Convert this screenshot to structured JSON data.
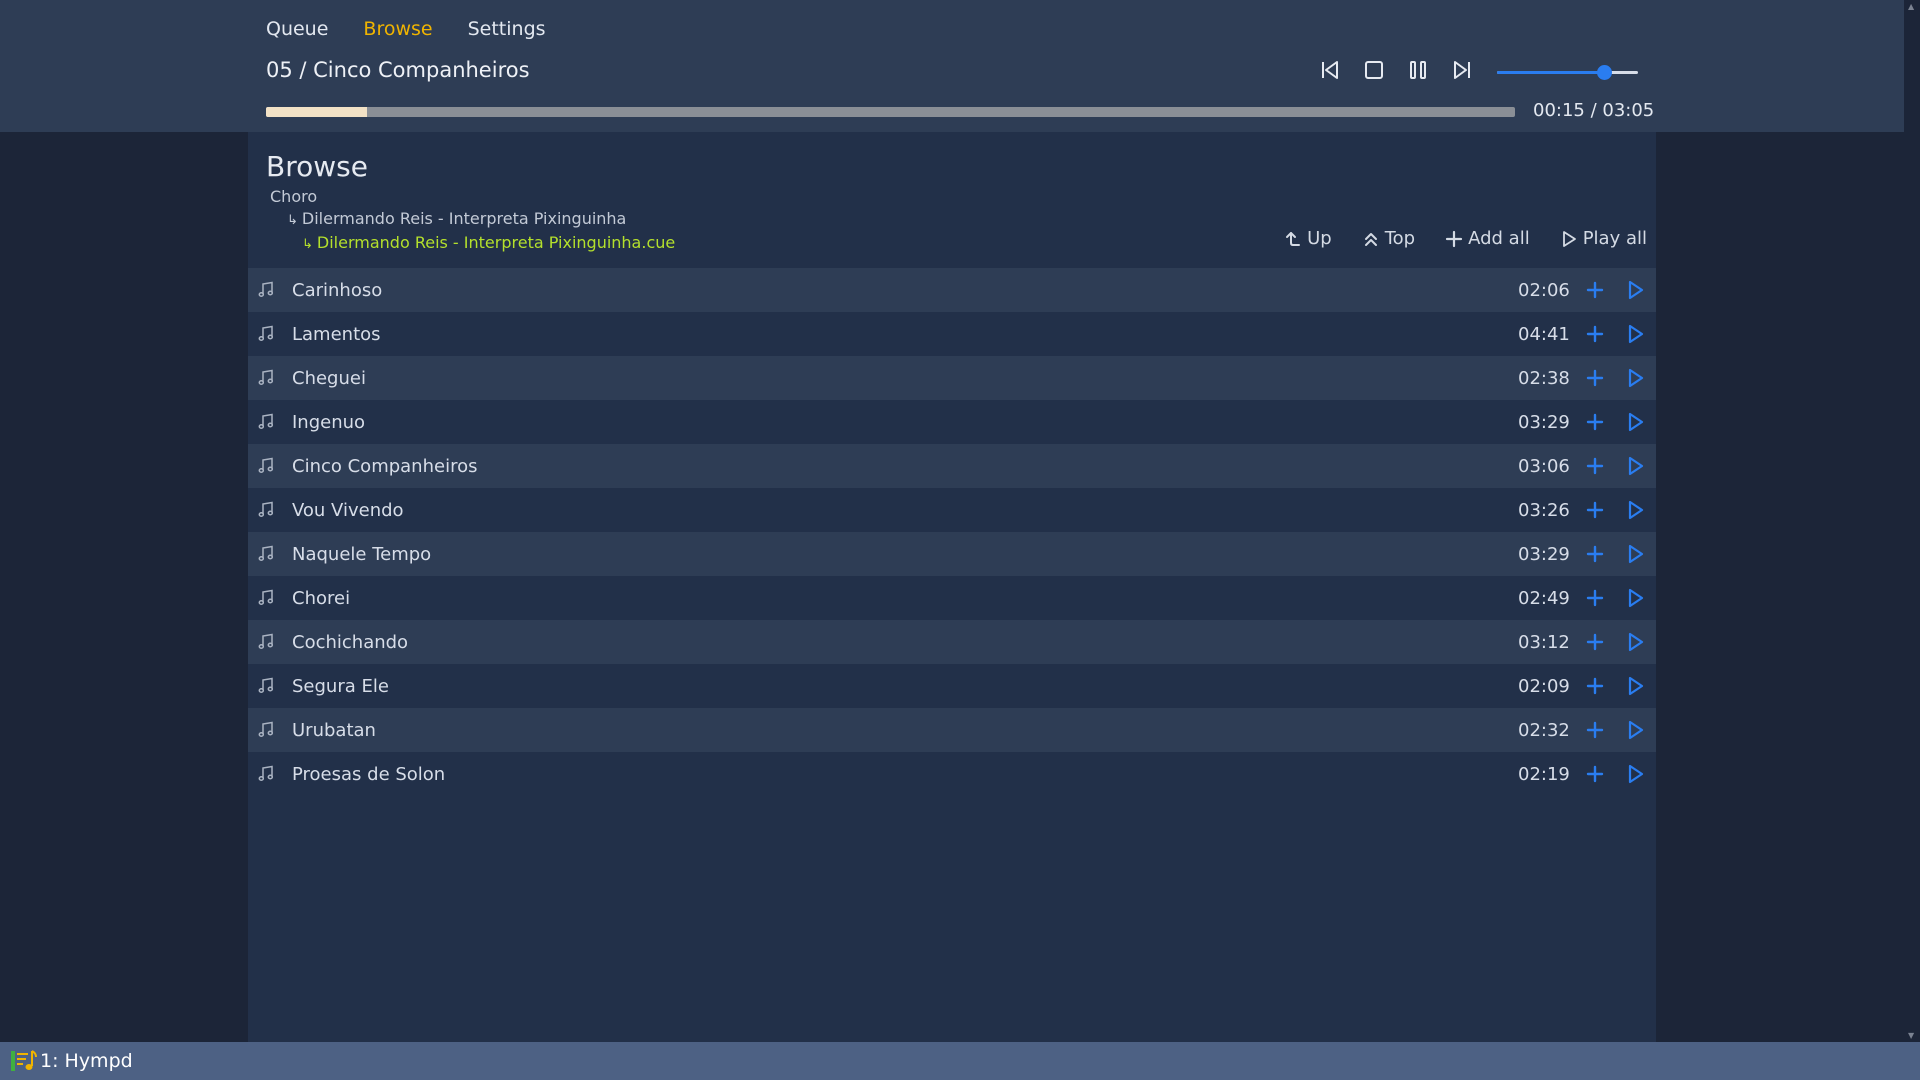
{
  "nav": {
    "tabs": [
      {
        "label": "Queue"
      },
      {
        "label": "Browse"
      },
      {
        "label": "Settings"
      }
    ],
    "active": "Browse"
  },
  "player": {
    "now_playing": "05 / Cinco Companheiros",
    "elapsed_total": "00:15 / 03:05",
    "progress_fraction": 0.081,
    "volume_fraction": 0.76,
    "controls": [
      "skip-previous-icon",
      "stop-icon",
      "pause-icon",
      "skip-next-icon"
    ]
  },
  "browse": {
    "title": "Browse",
    "breadcrumb": [
      "Choro",
      "Dilermando Reis - Interpreta Pixinguinha",
      "Dilermando Reis - Interpreta Pixinguinha.cue"
    ],
    "actions": [
      {
        "label": "Up",
        "icon": "up-arrow-icon"
      },
      {
        "label": "Top",
        "icon": "double-chevron-up-icon"
      },
      {
        "label": "Add all",
        "icon": "plus-icon"
      },
      {
        "label": "Play all",
        "icon": "play-icon"
      }
    ],
    "tracks": [
      {
        "title": "Carinhoso",
        "duration": "02:06"
      },
      {
        "title": "Lamentos",
        "duration": "04:41"
      },
      {
        "title": "Cheguei",
        "duration": "02:38"
      },
      {
        "title": "Ingenuo",
        "duration": "03:29"
      },
      {
        "title": "Cinco Companheiros",
        "duration": "03:06"
      },
      {
        "title": "Vou Vivendo",
        "duration": "03:26"
      },
      {
        "title": "Naquele Tempo",
        "duration": "03:29"
      },
      {
        "title": "Chorei",
        "duration": "02:49"
      },
      {
        "title": "Cochichando",
        "duration": "03:12"
      },
      {
        "title": "Segura Ele",
        "duration": "02:09"
      },
      {
        "title": "Urubatan",
        "duration": "02:32"
      },
      {
        "title": "Proesas de Solon",
        "duration": "02:19"
      }
    ]
  },
  "statusbar": {
    "label": "1: Hympd"
  },
  "colors": {
    "accent": "#2a7df0",
    "active_tab": "#f0b400",
    "breadcrumb_current": "#b4e02c",
    "header_bg": "#2e3d55",
    "panel_bg": "#223049",
    "page_bg": "#1c2538",
    "statusbar_bg": "#4d6184"
  }
}
